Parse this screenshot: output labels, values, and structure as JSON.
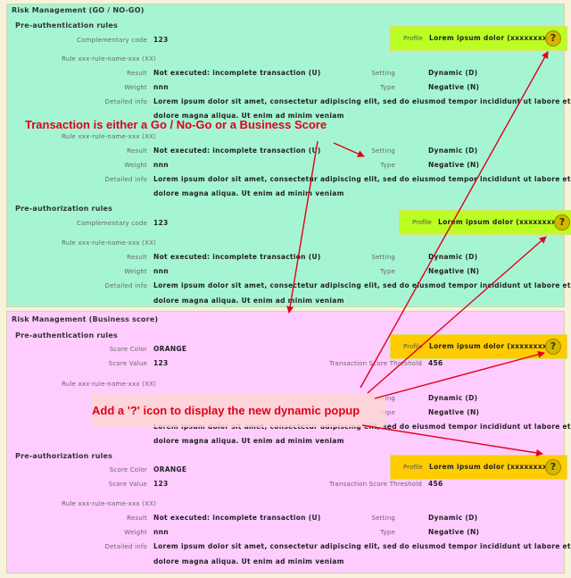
{
  "go_panel": {
    "title": "Risk Management (GO / NO-GO)",
    "preauth_title": "Pre-authentication rules",
    "preauthz_title": "Pre-authorization rules",
    "complementary_label": "Complementary code",
    "complementary_value": "123",
    "complementary_value_2": "123",
    "profile_label": "Profile",
    "profile_value": "Lorem ipsum dolor (xxxxxxxx)",
    "rule_name": "Rule xxx-rule-name-xxx (XX)",
    "result_label": "Result",
    "result_value": "Not executed: incomplete transaction (U)",
    "weight_label": "Weight",
    "weight_value": "nnn",
    "detailed_label": "Detailed info",
    "detailed_line1": "Lorem ipsum dolor sit amet, consectetur adipiscing elit, sed do eiusmod tempor incididunt ut labore et",
    "detailed_line2": "dolore magna aliqua. Ut enim ad minim veniam",
    "setting_label": "Setting",
    "setting_value": "Dynamic (D)",
    "type_label": "Type",
    "type_value": "Negative (N)"
  },
  "biz_panel": {
    "title": "Risk Management (Business score)",
    "preauth_title": "Pre-authentication rules",
    "preauthz_title": "Pre-authorization rules",
    "score_color_label": "Score Color",
    "score_color_value": "ORANGE",
    "score_value_label": "Score Value",
    "score_value_value": "123",
    "threshold_label": "Transaction Score Threshold",
    "threshold_value": "456",
    "profile_label": "Profile",
    "profile_value": "Lorem ipsum dolor (xxxxxxxx)",
    "rule_name": "Rule xxx-rule-name-xxx (XX)",
    "result_label": "Result",
    "result_value": "Not executed: incomplete transaction (U)",
    "weight_label": "Weight",
    "weight_value": "nnn",
    "detailed_label": "Detailed info",
    "detailed_line1": "Lorem ipsum dolor sit amet, consectetur adipiscing elit, sed do eiusmod tempor incididunt ut labore et",
    "detailed_line2": "dolore magna aliqua. Ut enim ad minim veniam",
    "setting_label": "Setting",
    "setting_value": "Dynamic (D)",
    "type_label": "Type",
    "type_value": "Negative (N)"
  },
  "help_icon": {
    "glyph": "?",
    "name": "help-icon"
  },
  "annotations": {
    "transaction_note": "Transaction is either a Go / No-Go or a Business Score",
    "icon_note": "Add a '?' icon to display the new dynamic popup"
  },
  "colors": {
    "go_panel_bg": "#a5f5d3",
    "biz_panel_bg": "#ffccff",
    "profile_go_bg": "#bbff22",
    "profile_biz_bg": "#ffcc00",
    "annotation_red": "#e0001a"
  }
}
